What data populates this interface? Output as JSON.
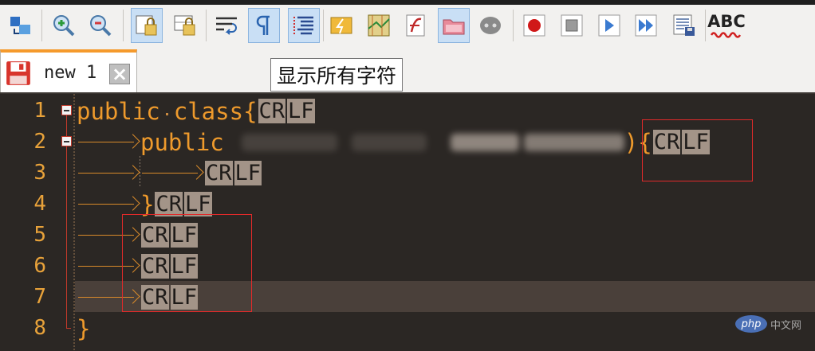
{
  "toolbar": {
    "buttons": [
      {
        "icon": "sync-scroll-icon"
      },
      {
        "icon": "zoom-in-icon"
      },
      {
        "icon": "zoom-out-icon"
      },
      {
        "icon": "sync-vertical-icon",
        "active": true
      },
      {
        "icon": "sync-horizontal-icon"
      },
      {
        "icon": "word-wrap-icon"
      },
      {
        "icon": "show-all-characters-icon",
        "active": true
      },
      {
        "icon": "indent-guide-icon",
        "active": true
      },
      {
        "icon": "user-defined-language-icon"
      },
      {
        "icon": "document-map-icon"
      },
      {
        "icon": "function-list-icon"
      },
      {
        "icon": "folder-as-workspace-icon",
        "active": true
      },
      {
        "icon": "monitoring-icon"
      },
      {
        "icon": "start-recording-icon"
      },
      {
        "icon": "stop-recording-icon"
      },
      {
        "icon": "playback-icon"
      },
      {
        "icon": "run-macro-multiple-icon"
      },
      {
        "icon": "save-macro-icon"
      },
      {
        "icon": "spell-check-icon"
      }
    ],
    "spellcheck_label": "ABC"
  },
  "tab": {
    "title": "new 1",
    "close_glyph": "×"
  },
  "tooltip": "显示所有字符",
  "editor": {
    "line_numbers": [
      "1",
      "2",
      "3",
      "4",
      "5",
      "6",
      "7",
      "8"
    ],
    "eol_cr": "CR",
    "eol_lf": "LF",
    "lines": {
      "l1_a": "public",
      "l1_b": "class{",
      "l2_a": "public",
      "l2_b": "){",
      "l4_a": "}",
      "l8_a": "}"
    }
  },
  "colors": {
    "code": "#ee9a2c",
    "line_number": "#e8a23a",
    "background": "#2b2724",
    "eol_marker": "#a39488",
    "annotation": "#e02a2a",
    "tab_accent": "#f59a2c"
  },
  "watermark": {
    "badge": "php",
    "text": "中文网"
  }
}
